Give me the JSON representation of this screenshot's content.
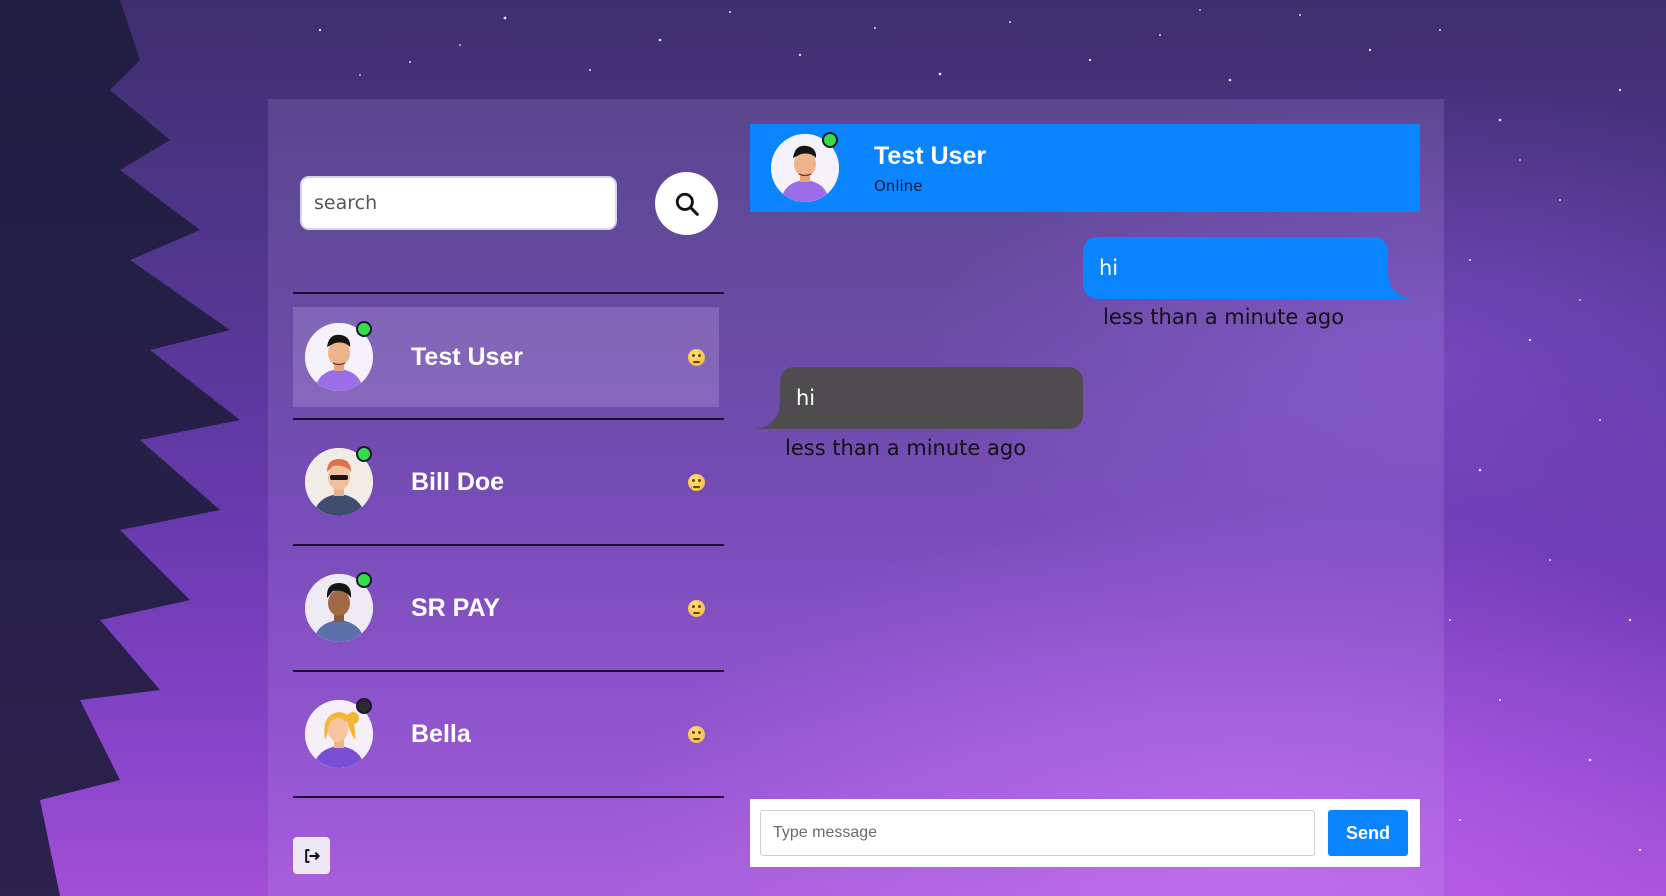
{
  "search": {
    "placeholder": "search"
  },
  "contacts": [
    {
      "name": "Test User",
      "online": true,
      "active": true
    },
    {
      "name": "Bill Doe",
      "online": true,
      "active": false
    },
    {
      "name": "SR PAY",
      "online": true,
      "active": false
    },
    {
      "name": "Bella",
      "online": false,
      "active": false
    }
  ],
  "chat": {
    "header": {
      "name": "Test User",
      "status": "Online"
    },
    "messages": [
      {
        "direction": "out",
        "text": "hi",
        "time": "less than a minute ago"
      },
      {
        "direction": "in",
        "text": "hi",
        "time": "less than a minute ago"
      }
    ]
  },
  "composer": {
    "placeholder": "Type message",
    "send_label": "Send"
  },
  "colors": {
    "accent": "#0a84ff",
    "online": "#2fe04a",
    "offline": "#2a2a33",
    "incoming_bubble": "#4e4c4f"
  },
  "icons": {
    "search": "search-icon",
    "logout": "logout-icon",
    "contact_status": "emoji-icon"
  }
}
